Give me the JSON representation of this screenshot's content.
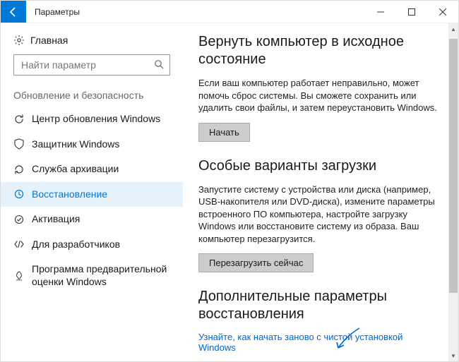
{
  "window": {
    "title": "Параметры"
  },
  "sidebar": {
    "home": "Главная",
    "search_placeholder": "Найти параметр",
    "category": "Обновление и безопасность",
    "items": [
      {
        "label": "Центр обновления Windows"
      },
      {
        "label": "Защитник Windows"
      },
      {
        "label": "Служба архивации"
      },
      {
        "label": "Восстановление"
      },
      {
        "label": "Активация"
      },
      {
        "label": "Для разработчиков"
      },
      {
        "label": "Программа предварительной оценки Windows"
      }
    ],
    "active_index": 3
  },
  "main": {
    "sections": [
      {
        "heading": "Вернуть компьютер в исходное состояние",
        "body": "Если ваш компьютер работает неправильно, может помочь сброс системы. Вы сможете сохранить или удалить свои файлы, и затем переустановить Windows.",
        "button": "Начать"
      },
      {
        "heading": "Особые варианты загрузки",
        "body": "Запустите систему с устройства или диска (например, USB-накопителя или DVD-диска), измените параметры встроенного ПО компьютера, настройте загрузку Windows или восстановите систему из образа. Ваш компьютер перезагрузится.",
        "button": "Перезагрузить сейчас"
      },
      {
        "heading": "Дополнительные параметры восстановления",
        "link": "Узнайте, как начать заново с чистой установкой Windows"
      }
    ]
  }
}
